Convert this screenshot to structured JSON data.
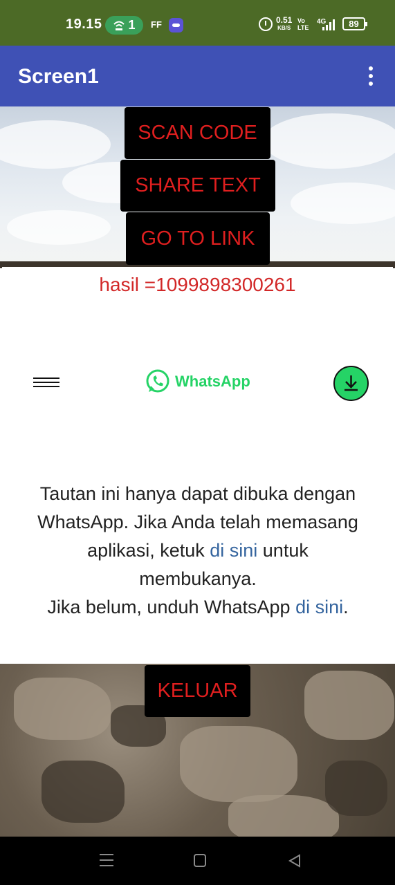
{
  "status_bar": {
    "time": "19.15",
    "hotspot_count": "1",
    "ff_label": "FF",
    "net_speed_value": "0.51",
    "net_speed_unit": "KB/S",
    "volte_top": "Vo",
    "volte_bottom": "LTE",
    "signal_label": "4G",
    "battery": "89"
  },
  "app_bar": {
    "title": "Screen1"
  },
  "buttons": {
    "scan_code": "SCAN CODE",
    "share_text": "SHARE TEXT",
    "go_to_link": "GO TO LINK",
    "keluar": "KELUAR"
  },
  "result": {
    "text": "hasil =1099898300261"
  },
  "webview": {
    "brand": "WhatsApp",
    "message_part1": "Tautan ini hanya dapat dibuka dengan WhatsApp. Jika Anda telah memasang aplikasi, ketuk ",
    "link1": "di sini",
    "message_part2": " untuk membukanya.",
    "message_part3": "Jika belum, unduh WhatsApp ",
    "link2": "di sini",
    "message_part4": "."
  },
  "colors": {
    "status_bar": "#4c6a26",
    "app_bar": "#3f51b5",
    "button_bg": "#000000",
    "button_text": "#e01f1f",
    "whatsapp_green": "#25d366",
    "link": "#34649e"
  },
  "icons": {
    "overflow": "overflow-menu-icon",
    "hamburger": "hamburger-icon",
    "download": "download-icon",
    "whatsapp": "whatsapp-logo-icon",
    "nav_recent": "nav-menu-icon",
    "nav_home": "nav-home-icon",
    "nav_back": "nav-back-icon"
  }
}
